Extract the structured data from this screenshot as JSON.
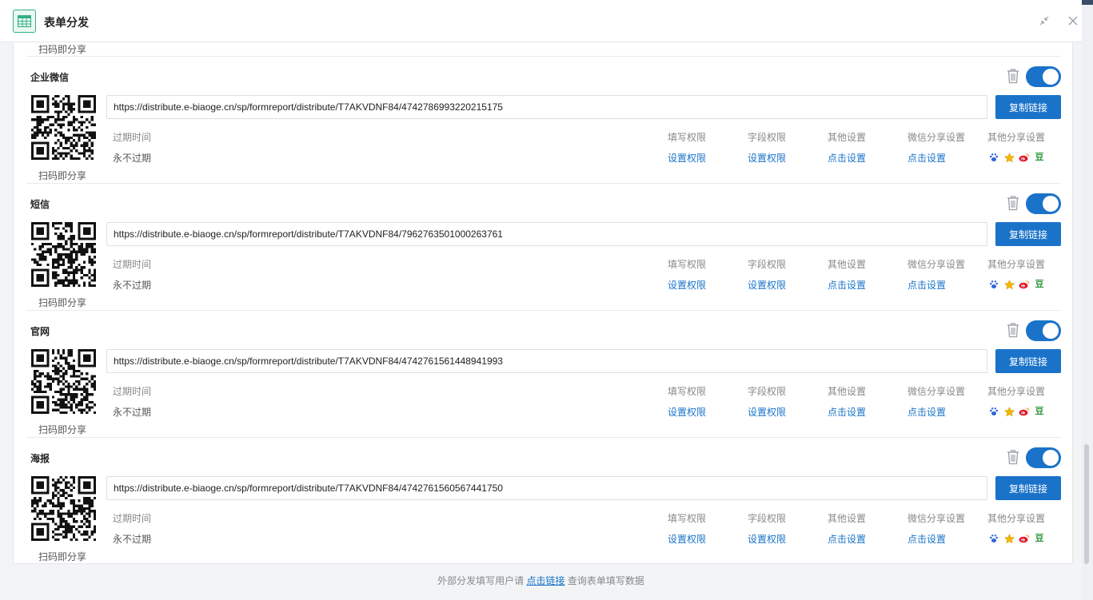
{
  "dialog": {
    "title": "表单分发"
  },
  "top_caption": "扫码即分享",
  "column_headers": {
    "expire": "过期时间",
    "fill_perm": "填写权限",
    "field_perm": "字段权限",
    "other": "其他设置",
    "wechat_share": "微信分享设置",
    "other_share": "其他分享设置"
  },
  "sections": [
    {
      "name": "企业微信",
      "url": "https://distribute.e-biaoge.cn/sp/formreport/distribute/T7AKVDNF84/4742786993220215175",
      "copy_label": "复制链接",
      "qr_caption": "扫码即分享",
      "expire": "永不过期",
      "fill_perm": "设置权限",
      "field_perm": "设置权限",
      "other": "点击设置",
      "wechat_share": "点击设置",
      "enabled": true
    },
    {
      "name": "短信",
      "url": "https://distribute.e-biaoge.cn/sp/formreport/distribute/T7AKVDNF84/7962763501000263761",
      "copy_label": "复制链接",
      "qr_caption": "扫码即分享",
      "expire": "永不过期",
      "fill_perm": "设置权限",
      "field_perm": "设置权限",
      "other": "点击设置",
      "wechat_share": "点击设置",
      "enabled": true
    },
    {
      "name": "官网",
      "url": "https://distribute.e-biaoge.cn/sp/formreport/distribute/T7AKVDNF84/4742761561448941993",
      "copy_label": "复制链接",
      "qr_caption": "扫码即分享",
      "expire": "永不过期",
      "fill_perm": "设置权限",
      "field_perm": "设置权限",
      "other": "点击设置",
      "wechat_share": "点击设置",
      "enabled": true
    },
    {
      "name": "海报",
      "url": "https://distribute.e-biaoge.cn/sp/formreport/distribute/T7AKVDNF84/4742761560567441750",
      "copy_label": "复制链接",
      "qr_caption": "扫码即分享",
      "expire": "永不过期",
      "fill_perm": "设置权限",
      "field_perm": "设置权限",
      "other": "点击设置",
      "wechat_share": "点击设置",
      "enabled": true
    }
  ],
  "share_icons": [
    "baidu-paw-icon",
    "star-icon",
    "weibo-icon",
    "douban-icon"
  ],
  "colors": {
    "accent": "#1a73c9",
    "logo": "#33b085"
  },
  "footer": {
    "before": "外部分发填写用户请",
    "link": "点击链接",
    "after": "查询表单填写数据"
  }
}
